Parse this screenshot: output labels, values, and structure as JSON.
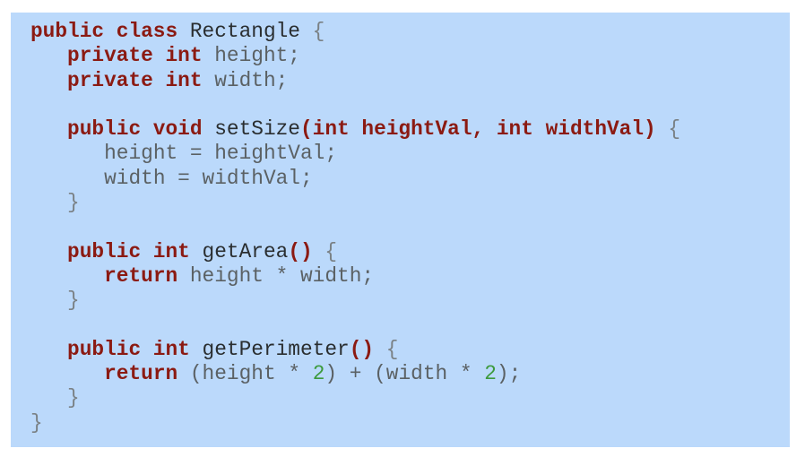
{
  "document": {
    "type": "code-snippet",
    "language": "Java",
    "background_color": "#bbd9fb",
    "colors": {
      "keyword": "#8b1a12",
      "identifier": "#2a2e30",
      "variable": "#5b6164",
      "punctuation": "#7a8185",
      "number": "#3c9a3c"
    },
    "lines": [
      {
        "indent": "",
        "tokens": [
          {
            "t": "kw",
            "v": "public class"
          },
          {
            "t": "sp",
            "v": " "
          },
          {
            "t": "id",
            "v": "Rectangle"
          },
          {
            "t": "sp",
            "v": " "
          },
          {
            "t": "punc",
            "v": "{"
          }
        ]
      },
      {
        "indent": "   ",
        "tokens": [
          {
            "t": "kw",
            "v": "private int"
          },
          {
            "t": "sp",
            "v": " "
          },
          {
            "t": "var",
            "v": "height;"
          }
        ]
      },
      {
        "indent": "   ",
        "tokens": [
          {
            "t": "kw",
            "v": "private int"
          },
          {
            "t": "sp",
            "v": " "
          },
          {
            "t": "var",
            "v": "width;"
          }
        ]
      },
      {
        "indent": "",
        "tokens": []
      },
      {
        "indent": "   ",
        "tokens": [
          {
            "t": "kw",
            "v": "public void"
          },
          {
            "t": "sp",
            "v": " "
          },
          {
            "t": "id",
            "v": "setSize"
          },
          {
            "t": "kw",
            "v": "(int heightVal, int widthVal)"
          },
          {
            "t": "sp",
            "v": " "
          },
          {
            "t": "punc",
            "v": "{"
          }
        ]
      },
      {
        "indent": "      ",
        "tokens": [
          {
            "t": "var",
            "v": "height = heightVal;"
          }
        ]
      },
      {
        "indent": "      ",
        "tokens": [
          {
            "t": "var",
            "v": "width = widthVal;"
          }
        ]
      },
      {
        "indent": "   ",
        "tokens": [
          {
            "t": "punc",
            "v": "}"
          }
        ]
      },
      {
        "indent": "",
        "tokens": []
      },
      {
        "indent": "   ",
        "tokens": [
          {
            "t": "kw",
            "v": "public int"
          },
          {
            "t": "sp",
            "v": " "
          },
          {
            "t": "id",
            "v": "getArea"
          },
          {
            "t": "kw",
            "v": "()"
          },
          {
            "t": "sp",
            "v": " "
          },
          {
            "t": "punc",
            "v": "{"
          }
        ]
      },
      {
        "indent": "      ",
        "tokens": [
          {
            "t": "kw",
            "v": "return"
          },
          {
            "t": "sp",
            "v": " "
          },
          {
            "t": "var",
            "v": "height * width;"
          }
        ]
      },
      {
        "indent": "   ",
        "tokens": [
          {
            "t": "punc",
            "v": "}"
          }
        ]
      },
      {
        "indent": "",
        "tokens": []
      },
      {
        "indent": "   ",
        "tokens": [
          {
            "t": "kw",
            "v": "public int"
          },
          {
            "t": "sp",
            "v": " "
          },
          {
            "t": "id",
            "v": "getPerimeter"
          },
          {
            "t": "kw",
            "v": "()"
          },
          {
            "t": "sp",
            "v": " "
          },
          {
            "t": "punc",
            "v": "{"
          }
        ]
      },
      {
        "indent": "      ",
        "tokens": [
          {
            "t": "kw",
            "v": "return"
          },
          {
            "t": "sp",
            "v": " "
          },
          {
            "t": "var",
            "v": "(height * "
          },
          {
            "t": "num",
            "v": "2"
          },
          {
            "t": "var",
            "v": ") + (width * "
          },
          {
            "t": "num",
            "v": "2"
          },
          {
            "t": "var",
            "v": ");"
          }
        ]
      },
      {
        "indent": "   ",
        "tokens": [
          {
            "t": "punc",
            "v": "}"
          }
        ]
      },
      {
        "indent": "",
        "tokens": [
          {
            "t": "punc",
            "v": "}"
          }
        ]
      }
    ]
  }
}
